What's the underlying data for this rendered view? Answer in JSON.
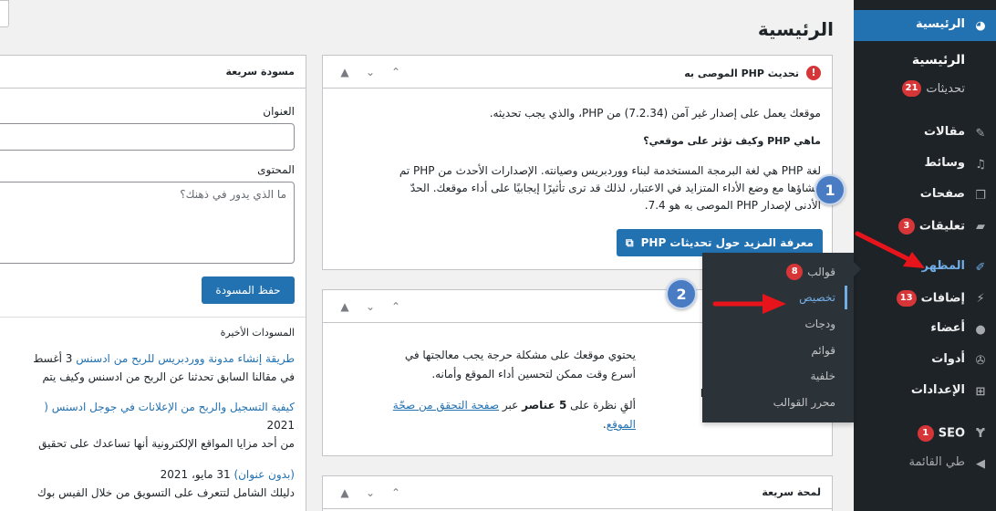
{
  "page": {
    "title": "الرئيسية"
  },
  "sidebar": {
    "dashboard": "الرئيسية",
    "home_sub": "الرئيسية",
    "updates_sub": "تحديثات",
    "updates_count": "21",
    "posts": "مقالات",
    "media": "وسائط",
    "pages": "صفحات",
    "comments": "تعليقات",
    "comments_count": "3",
    "appearance": "المظهر",
    "plugins": "إضافات",
    "plugins_count": "13",
    "users": "أعضاء",
    "tools": "أدوات",
    "settings": "الإعدادات",
    "seo": "SEO",
    "seo_count": "1",
    "collapse": "طي القائمة"
  },
  "flyout": {
    "themes": "قوالب",
    "themes_count": "8",
    "customize": "تخصيص",
    "widgets": "ودجات",
    "menus": "قوائم",
    "background": "خلفية",
    "theme_editor": "محرر القوالب"
  },
  "php_box": {
    "title": "تحديث PHP الموصى به",
    "p1": "موقعك يعمل على إصدار غير آمن (7.2.34) من PHP، والذي يجب تحديثه.",
    "q": "ماهي PHP وكيف تؤثر على موقعي؟",
    "p2_l1": "لغة PHP هي لغة البرمجة المستخدمة لبناء ووردبريس وصيانته. الإصدارات الأحدث من PHP تم",
    "p2_l2": "إنشاؤها مع وضع الأداء المتزايد في الاعتبار، لذلك قد ترى تأثيرًا إيجابيًا على أداء موقعك. الحدّ",
    "p2_l3": "الأدنى لإصدار PHP الموصى به هو 7.4.",
    "button": "معرفة المزيد حول تحديثات PHP"
  },
  "health_box": {
    "p1_l1": "يحتوي موقعك على مشكلة حرجة يجب معالجتها في",
    "p1_l2": "أسرع وقت ممكن لتحسين أداء الموقع وأمانه.",
    "p2_pre": "ألقِ نظرة على",
    "p2_bold": "5 عناصر",
    "p2_mid": "عبر",
    "p2_link1": "صفحة التحقق من صحّة",
    "p2_link2": "الموقع",
    "p2_end": ".",
    "cut_letter": "ا"
  },
  "glance_box": {
    "title": "لمحة سريعة"
  },
  "quick_draft": {
    "title": "مسودة سريعة",
    "title_label": "العنوان",
    "content_label": "المحتوى",
    "content_placeholder": "ما الذي يدور في ذهنك؟",
    "save": "حفظ المسودة",
    "recent": "المسودات الأخيرة",
    "d1_link": "طريقة إنشاء مدونة ووردبريس للربح من ادسنس",
    "d1_date": "3 أغسط",
    "d1_excerpt": "في مقالنا السابق تحدثنا عن الربح من ادسنس وكيف يتم",
    "d2_link": "كيفية التسجيل والربح من الإعلانات في جوجل ادسنس (",
    "d2_year": "2021",
    "d2_excerpt": "من أحد مزايا المواقع الإلكترونية أنها تساعدك على تحقيق",
    "d3_link": "(بدون عنوان)",
    "d3_date": "31 مايو، 2021",
    "d3_excerpt": "دليلك الشامل لتتعرف على التسويق من خلال الفيس بوك"
  },
  "annotations": {
    "one": "1",
    "two": "2"
  },
  "colors": {
    "accent": "#2271b1",
    "sidebar": "#1d2327",
    "badge": "#d63638",
    "arrow": "#e8141b"
  }
}
